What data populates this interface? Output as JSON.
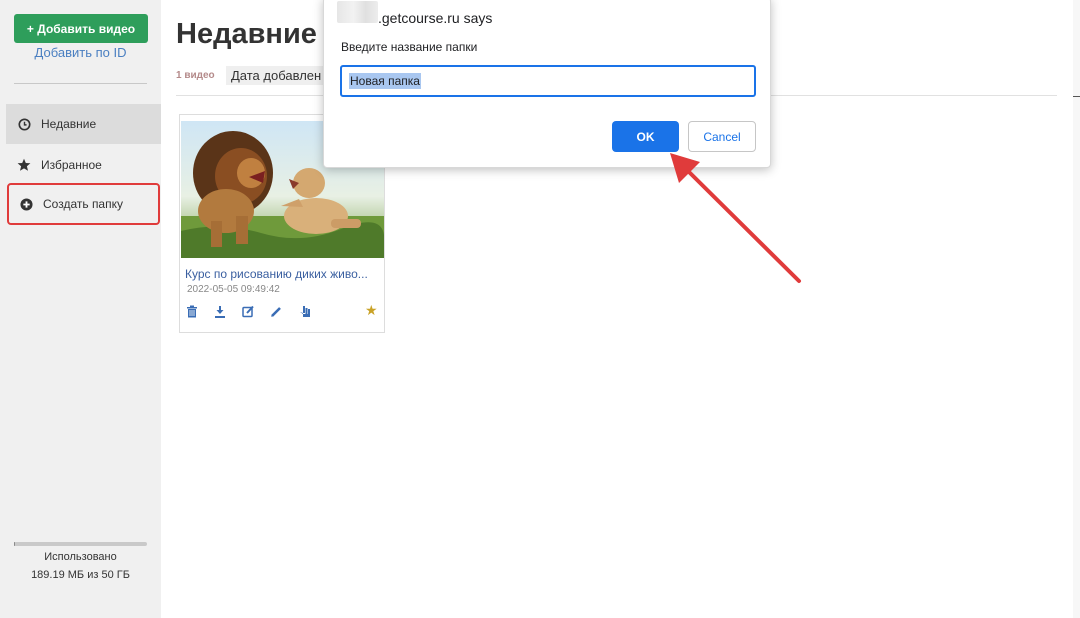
{
  "sidebar": {
    "add_video_label": "+ Добавить видео",
    "add_by_id_label": "Добавить по ID",
    "items": [
      {
        "label": "Недавние",
        "icon": "clock-icon"
      },
      {
        "label": "Избранное",
        "icon": "star-icon"
      },
      {
        "label": "Создать папку",
        "icon": "plus-circle-icon"
      }
    ],
    "usage": {
      "label": "Использовано",
      "value": "189.19 МБ из 50 ГБ",
      "fraction": 0.0037
    }
  },
  "main": {
    "title": "Недавние",
    "video_count": "1 видео",
    "sort_value": "Дата добавлен",
    "videos": [
      {
        "title": "Курс по рисованию диких живо...",
        "date": "2022-05-05 09:49:42",
        "actions": [
          "trash-icon",
          "download-icon",
          "edit-square-icon",
          "pencil-icon",
          "hand-icon"
        ],
        "favorite": true
      }
    ]
  },
  "dialog": {
    "origin_suffix": ".getcourse.ru says",
    "message": "Введите название папки",
    "input_value": "Новая папка",
    "ok_label": "OK",
    "cancel_label": "Cancel"
  },
  "colors": {
    "green_button": "#2e9e5b",
    "link_blue": "#4a7fc1",
    "dialog_blue": "#1a73e8",
    "highlight_red": "#e03b3b",
    "star_gold": "#c9a227"
  }
}
